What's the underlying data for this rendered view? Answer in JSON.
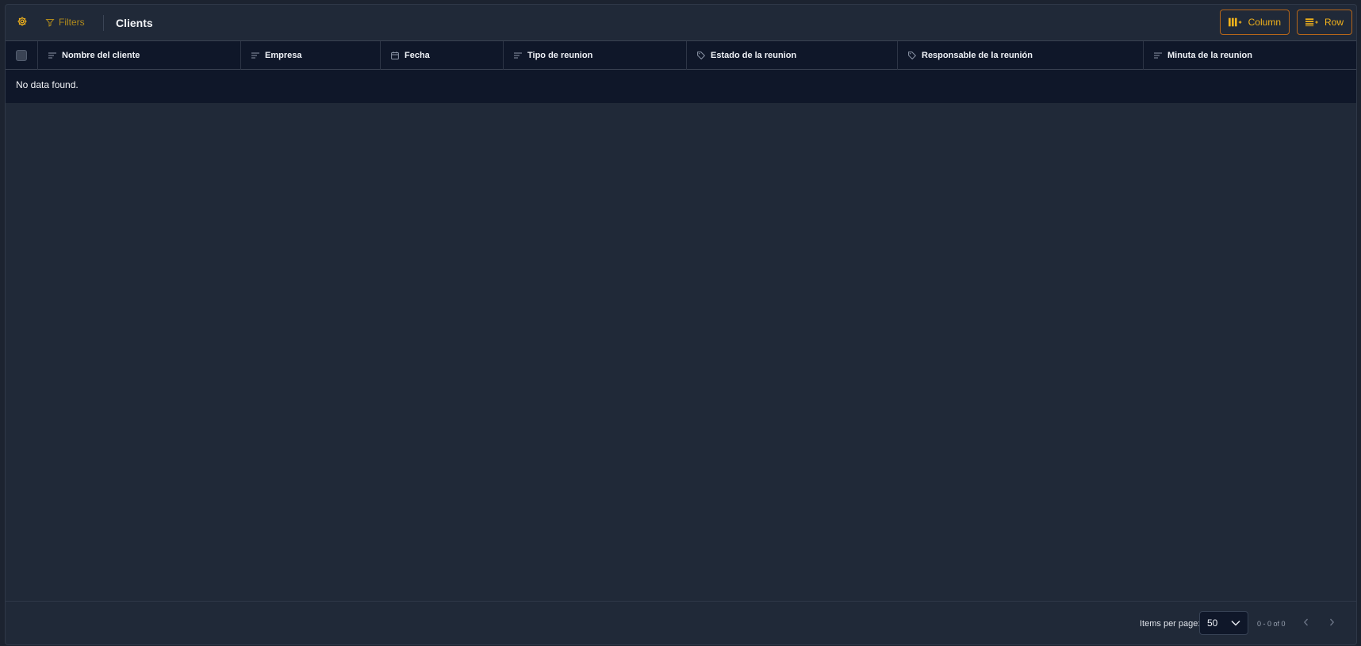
{
  "toolbar": {
    "filters_label": "Filters",
    "title": "Clients",
    "add_column_label": "Column",
    "add_row_label": "Row"
  },
  "icons": {
    "settings": "gear-icon",
    "filters": "filter-icon",
    "add_column": "add-column-icon",
    "add_row": "add-row-icon"
  },
  "colors": {
    "accent": "#f3b31b",
    "accent_border": "#b6661a",
    "filters_text": "#b08a1c",
    "panel_bg": "#202938",
    "table_bg": "#0f1729"
  },
  "table": {
    "columns": [
      {
        "label": "Nombre del cliente",
        "icon": "text-icon"
      },
      {
        "label": "Empresa",
        "icon": "text-icon"
      },
      {
        "label": "Fecha",
        "icon": "calendar-icon"
      },
      {
        "label": "Tipo de reunion",
        "icon": "text-icon"
      },
      {
        "label": "Estado de la reunion",
        "icon": "tag-icon"
      },
      {
        "label": "Responsable de la reunión",
        "icon": "tag-icon"
      },
      {
        "label": "Minuta de la reunion",
        "icon": "text-icon"
      }
    ],
    "empty_message": "No data found."
  },
  "pagination": {
    "items_per_page_label": "Items per page:",
    "items_per_page_value": "50",
    "range_label": "0 - 0 of 0"
  }
}
